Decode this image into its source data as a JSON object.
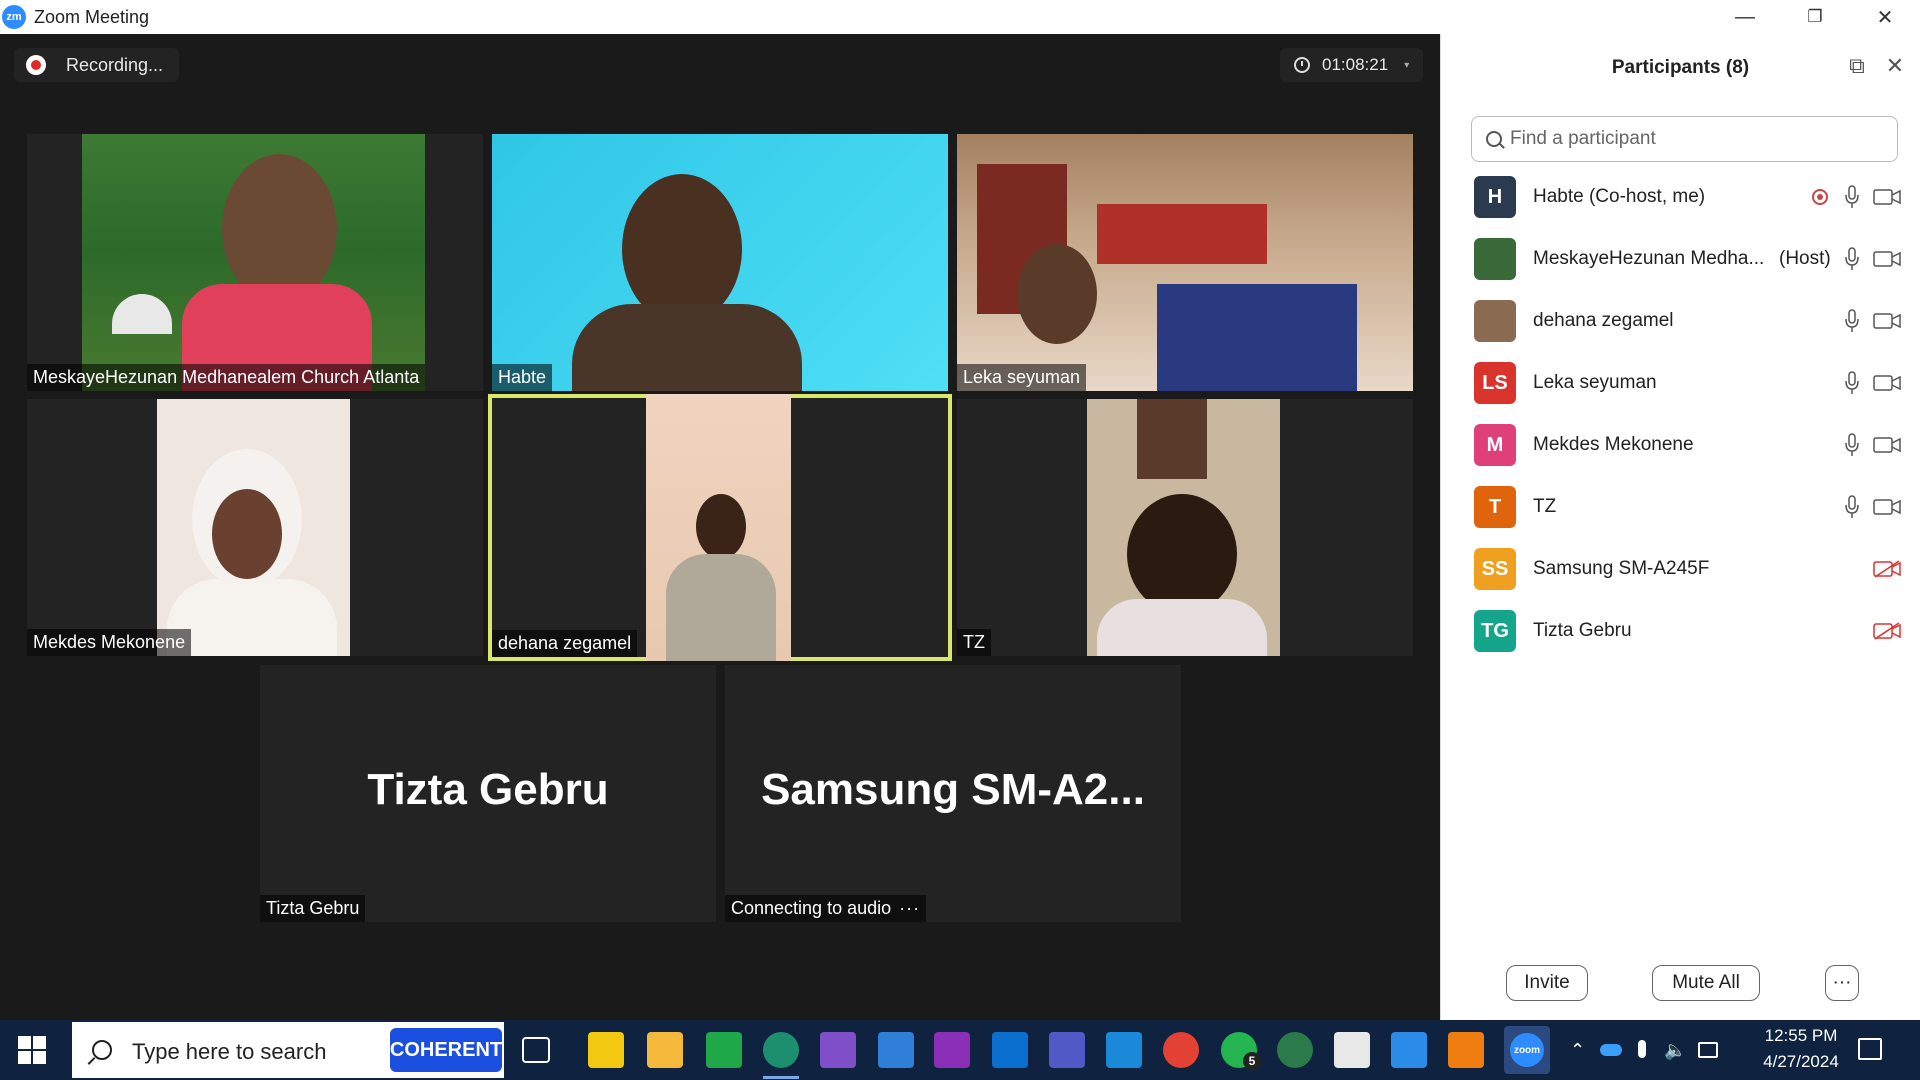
{
  "window": {
    "title": "Zoom Meeting",
    "logo_text": "zm",
    "minimize": "—",
    "restore": "❐",
    "close": "✕"
  },
  "meeting": {
    "recording_label": "Recording...",
    "timer": "01:08:21",
    "timer_caret": "▾",
    "tiles": [
      {
        "name": "MeskayeHezunan Medhanealem Church Atlanta"
      },
      {
        "name": "Habte"
      },
      {
        "name": "Leka seyuman"
      },
      {
        "name": "Mekdes Mekonene"
      },
      {
        "name": "dehana zegamel"
      },
      {
        "name": "TZ"
      },
      {
        "name": "Tizta Gebru",
        "big_label": "Tizta Gebru"
      },
      {
        "name": "Connecting to audio",
        "name_suffix": "···",
        "big_label": "Samsung  SM-A2..."
      }
    ]
  },
  "panel": {
    "title": "Participants (8)",
    "popout_icon": "⧉",
    "close_icon": "✕",
    "search_placeholder": "Find a participant",
    "participants": [
      {
        "initials": "H",
        "name": "Habte (Co-host, me)",
        "role": "",
        "color": "#2b3a4e",
        "video_off": false
      },
      {
        "initials": "",
        "name": "MeskayeHezunan Medha...",
        "role": "(Host)",
        "color": "#3a6a3a",
        "video_off": false
      },
      {
        "initials": "",
        "name": "dehana zegamel",
        "role": "",
        "color": "#8a6a50",
        "video_off": false
      },
      {
        "initials": "LS",
        "name": "Leka seyuman",
        "role": "",
        "color": "#d9342b",
        "video_off": false
      },
      {
        "initials": "M",
        "name": "Mekdes Mekonene",
        "role": "",
        "color": "#e0407a",
        "video_off": false
      },
      {
        "initials": "T",
        "name": "TZ",
        "role": "",
        "color": "#e0640c",
        "video_off": false
      },
      {
        "initials": "SS",
        "name": "Samsung SM-A245F",
        "role": "",
        "color": "#f0a020",
        "video_off": true
      },
      {
        "initials": "TG",
        "name": "Tizta Gebru",
        "role": "",
        "color": "#15a58a",
        "video_off": true
      }
    ],
    "invite_label": "Invite",
    "mute_all_label": "Mute All",
    "more_label": "···"
  },
  "taskbar": {
    "search_text": "Type here to search",
    "coherent_label": "COHERENT",
    "time": "12:55 PM",
    "date": "4/27/2024",
    "whatsapp_badge": "5",
    "zoom_label": "zoom"
  }
}
